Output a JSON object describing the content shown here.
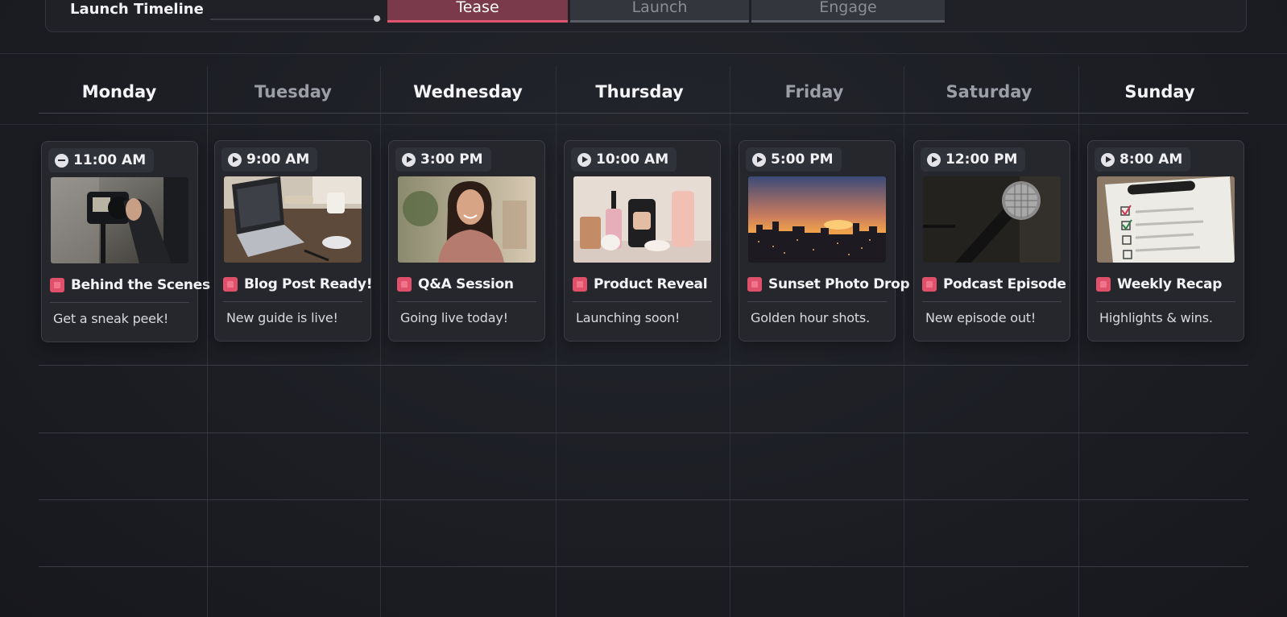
{
  "timeline": {
    "title": "Launch Timeline",
    "phases": [
      {
        "label": "Tease",
        "active": true
      },
      {
        "label": "Launch",
        "active": false
      },
      {
        "label": "Engage",
        "active": false
      }
    ]
  },
  "days": [
    {
      "label": "Monday",
      "emphasis": "bright"
    },
    {
      "label": "Tuesday",
      "emphasis": "dim"
    },
    {
      "label": "Wednesday",
      "emphasis": "bright"
    },
    {
      "label": "Thursday",
      "emphasis": "bright"
    },
    {
      "label": "Friday",
      "emphasis": "dim"
    },
    {
      "label": "Saturday",
      "emphasis": "dim"
    },
    {
      "label": "Sunday",
      "emphasis": "bright"
    }
  ],
  "posts": [
    {
      "time": "11:00 AM",
      "status_icon": "minus-circle-icon",
      "image": "camera-behind-scenes-photo",
      "title": "Behind the Scenes",
      "caption": "Get a sneak peek!"
    },
    {
      "time": "9:00 AM",
      "status_icon": "play-circle-icon",
      "image": "laptop-desk-photo",
      "title": "Blog Post Ready!",
      "caption": "New guide is live!"
    },
    {
      "time": "3:00 PM",
      "status_icon": "play-circle-icon",
      "image": "smiling-woman-photo",
      "title": "Q&A Session",
      "caption": "Going live today!"
    },
    {
      "time": "10:00 AM",
      "status_icon": "play-circle-icon",
      "image": "skincare-products-photo",
      "title": "Product Reveal",
      "caption": "Launching soon!"
    },
    {
      "time": "5:00 PM",
      "status_icon": "play-circle-icon",
      "image": "city-sunset-photo",
      "title": "Sunset Photo Drop",
      "caption": "Golden hour shots."
    },
    {
      "time": "12:00 PM",
      "status_icon": "play-circle-icon",
      "image": "microphone-photo",
      "title": "Podcast Episode",
      "caption": "New episode out!"
    },
    {
      "time": "8:00 AM",
      "status_icon": "play-circle-icon",
      "image": "checklist-paper-photo",
      "title": "Weekly Recap",
      "caption": "Highlights & wins."
    }
  ],
  "colors": {
    "accent": "#e0506b",
    "active_phase_bg": "#7a3a4b",
    "background": "#1c1e24",
    "card": "#25272d"
  }
}
